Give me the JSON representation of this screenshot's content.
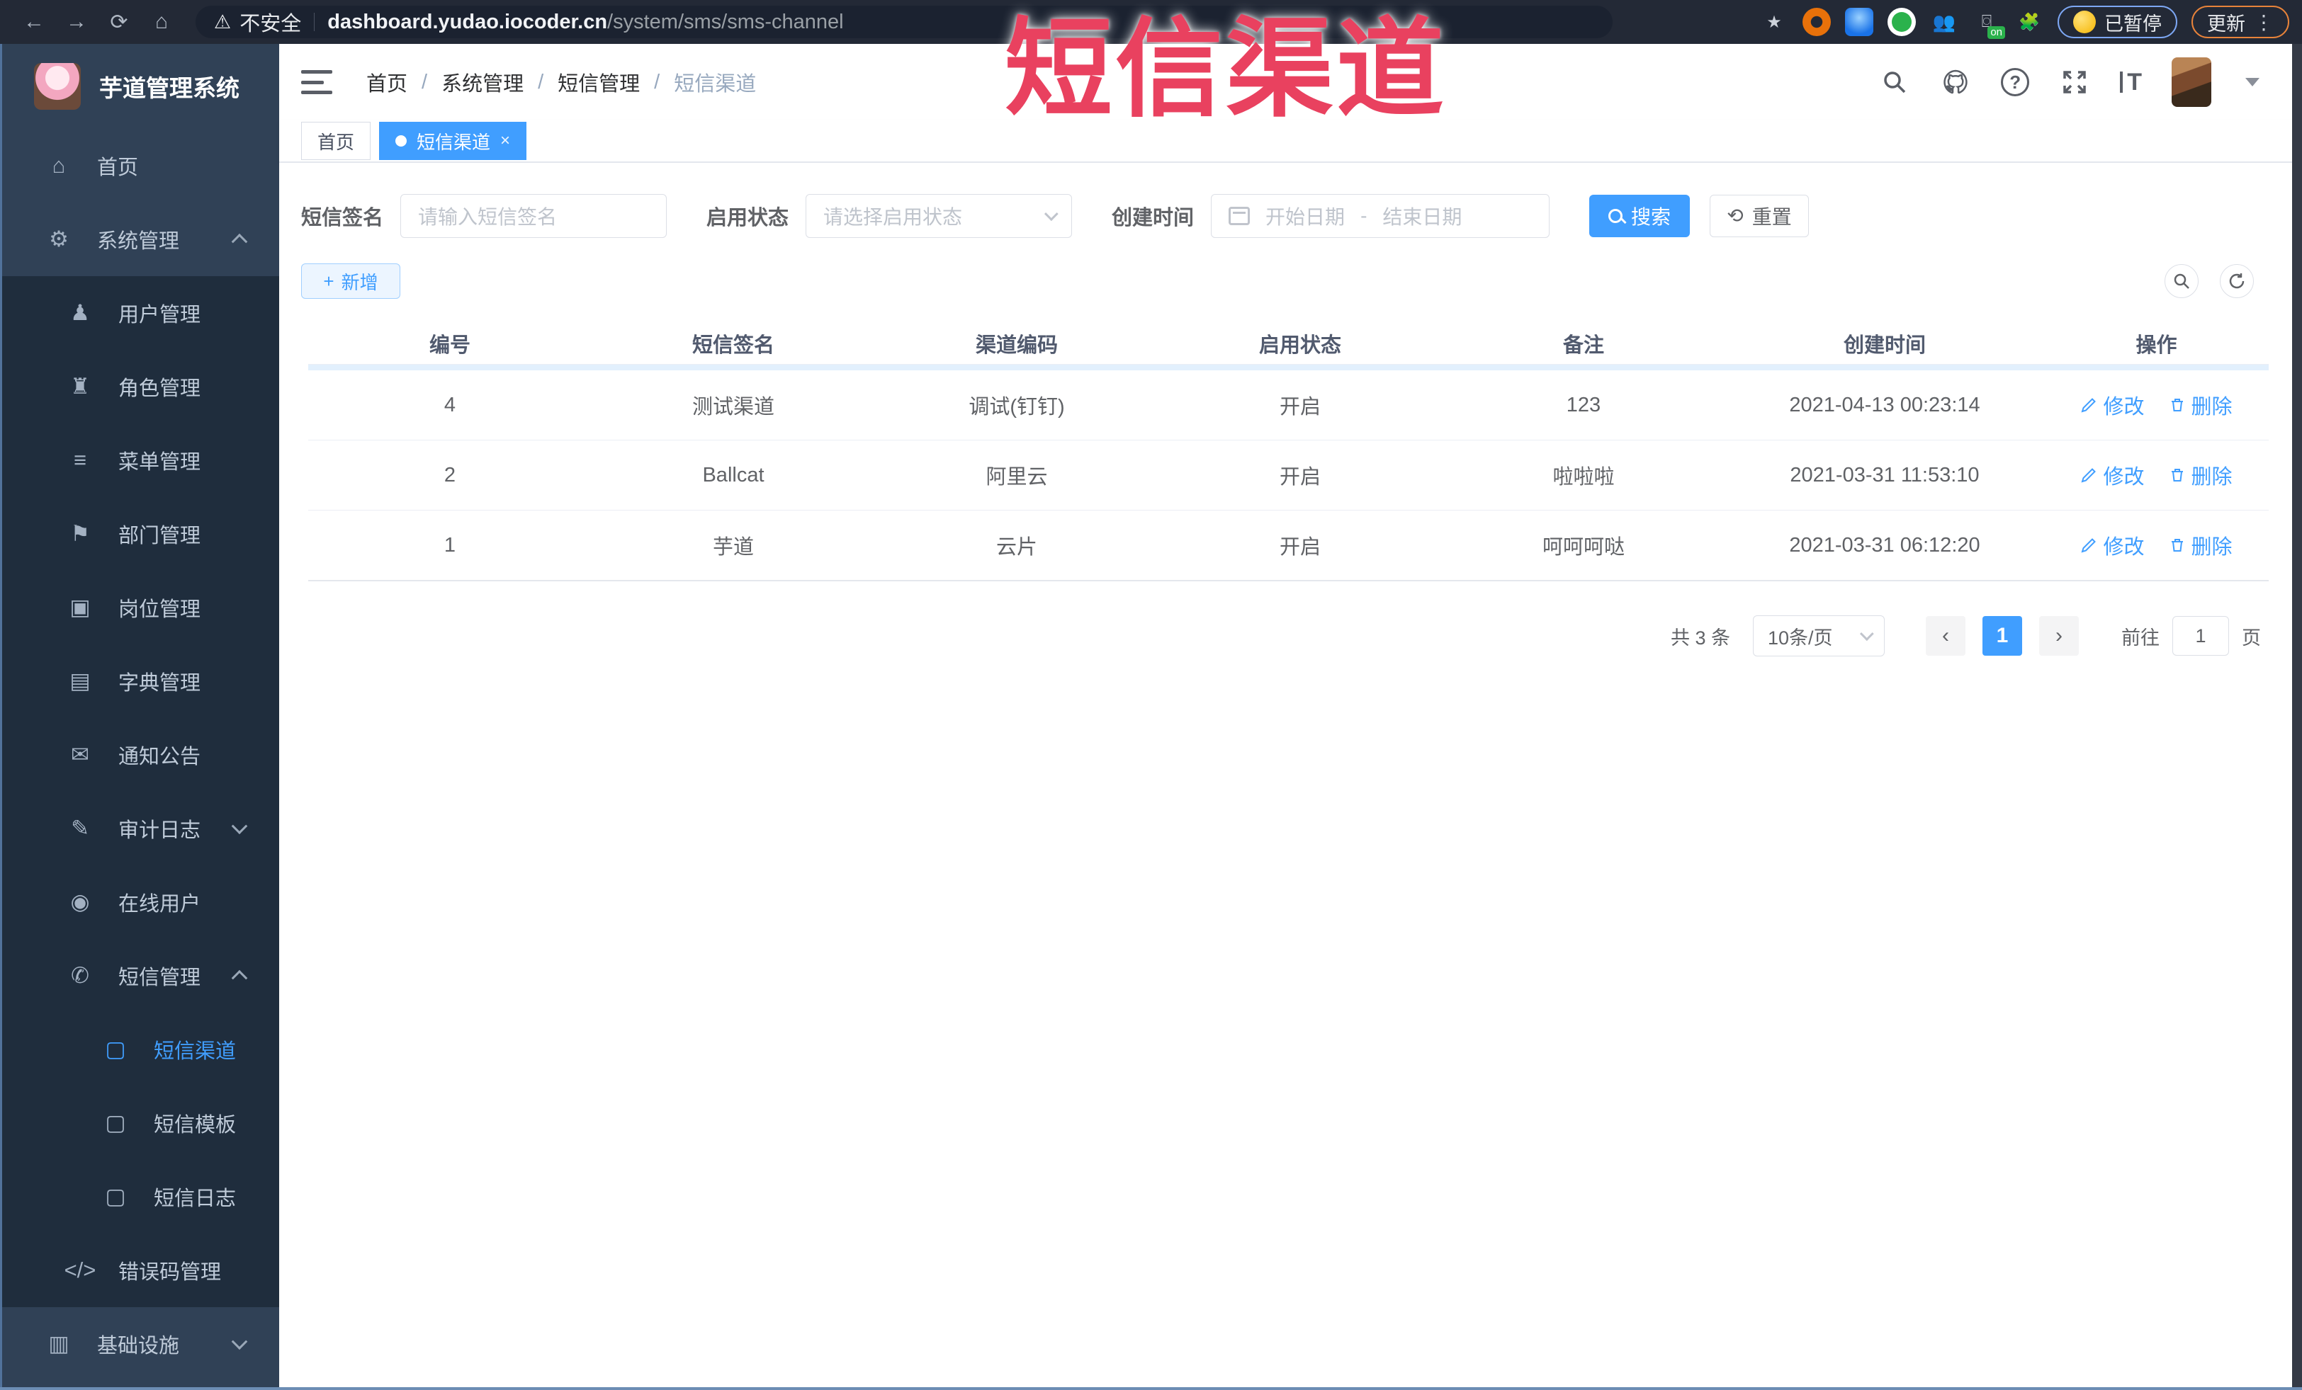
{
  "browser": {
    "security_label": "不安全",
    "url_domain": "dashboard.yudao.iocoder.cn",
    "url_path": "/system/sms/sms-channel",
    "paused_badge_label": "已暂停",
    "update_button_label": "更新"
  },
  "annotation": {
    "title": "短信渠道",
    "color": "#e9415f"
  },
  "sidebar": {
    "app_title": "芋道管理系统",
    "items": [
      {
        "label": "首页",
        "icon_name": "home-icon",
        "glyph": "⌂",
        "level": 1
      },
      {
        "label": "系统管理",
        "icon_name": "gear-icon",
        "glyph": "⚙",
        "level": 1,
        "arrow": "up"
      },
      {
        "label": "用户管理",
        "icon_name": "user-icon",
        "glyph": "♟",
        "level": 2
      },
      {
        "label": "角色管理",
        "icon_name": "role-icon",
        "glyph": "♜",
        "level": 2
      },
      {
        "label": "菜单管理",
        "icon_name": "menu-icon",
        "glyph": "≡",
        "level": 2
      },
      {
        "label": "部门管理",
        "icon_name": "dept-icon",
        "glyph": "⚑",
        "level": 2
      },
      {
        "label": "岗位管理",
        "icon_name": "post-icon",
        "glyph": "▣",
        "level": 2
      },
      {
        "label": "字典管理",
        "icon_name": "dict-icon",
        "glyph": "▤",
        "level": 2
      },
      {
        "label": "通知公告",
        "icon_name": "notice-icon",
        "glyph": "✉",
        "level": 2
      },
      {
        "label": "审计日志",
        "icon_name": "audit-log-icon",
        "glyph": "✎",
        "level": 2,
        "arrow": "down"
      },
      {
        "label": "在线用户",
        "icon_name": "online-user-icon",
        "glyph": "◉",
        "level": 2
      },
      {
        "label": "短信管理",
        "icon_name": "sms-icon",
        "glyph": "✆",
        "level": 2,
        "arrow": "up"
      },
      {
        "label": "短信渠道",
        "icon_name": "doc-icon",
        "glyph": "▢",
        "level": 3,
        "active": true
      },
      {
        "label": "短信模板",
        "icon_name": "doc-icon",
        "glyph": "▢",
        "level": 3
      },
      {
        "label": "短信日志",
        "icon_name": "doc-icon",
        "glyph": "▢",
        "level": 3
      },
      {
        "label": "错误码管理",
        "icon_name": "code-icon",
        "glyph": "</>",
        "level": 2
      },
      {
        "label": "基础设施",
        "icon_name": "infra-icon",
        "glyph": "▥",
        "level": 1,
        "arrow": "down"
      }
    ]
  },
  "header": {
    "breadcrumbs": [
      "首页",
      "系统管理",
      "短信管理",
      "短信渠道"
    ]
  },
  "tabs": [
    {
      "label": "首页",
      "active": false
    },
    {
      "label": "短信渠道",
      "active": true,
      "closable": true
    }
  ],
  "filters": {
    "sign_label": "短信签名",
    "sign_placeholder": "请输入短信签名",
    "status_label": "启用状态",
    "status_placeholder": "请选择启用状态",
    "date_label": "创建时间",
    "date_start_placeholder": "开始日期",
    "date_separator": "-",
    "date_end_placeholder": "结束日期",
    "search_button": "搜索",
    "reset_button": "重置"
  },
  "toolbar": {
    "add_button": "新增",
    "add_plus": "+"
  },
  "table": {
    "columns": [
      "编号",
      "短信签名",
      "渠道编码",
      "启用状态",
      "备注",
      "创建时间",
      "操作"
    ],
    "edit_label": "修改",
    "delete_label": "删除",
    "rows": [
      {
        "id": "4",
        "sign": "测试渠道",
        "code": "调试(钉钉)",
        "status": "开启",
        "remark": "123",
        "created": "2021-04-13 00:23:14"
      },
      {
        "id": "2",
        "sign": "Ballcat",
        "code": "阿里云",
        "status": "开启",
        "remark": "啦啦啦",
        "created": "2021-03-31 11:53:10"
      },
      {
        "id": "1",
        "sign": "芋道",
        "code": "云片",
        "status": "开启",
        "remark": "呵呵呵哒",
        "created": "2021-03-31 06:12:20"
      }
    ]
  },
  "pagination": {
    "total": "共 3 条",
    "page_size": "10条/页",
    "prev": "‹",
    "next": "›",
    "current_page": "1",
    "goto_label": "前往",
    "goto_value": "1",
    "page_unit": "页"
  },
  "colors": {
    "primary": "#409EFF",
    "sidebar_bg": "#304156",
    "submenu_bg": "#1f2d3d",
    "annotation_red": "#e9415f"
  }
}
